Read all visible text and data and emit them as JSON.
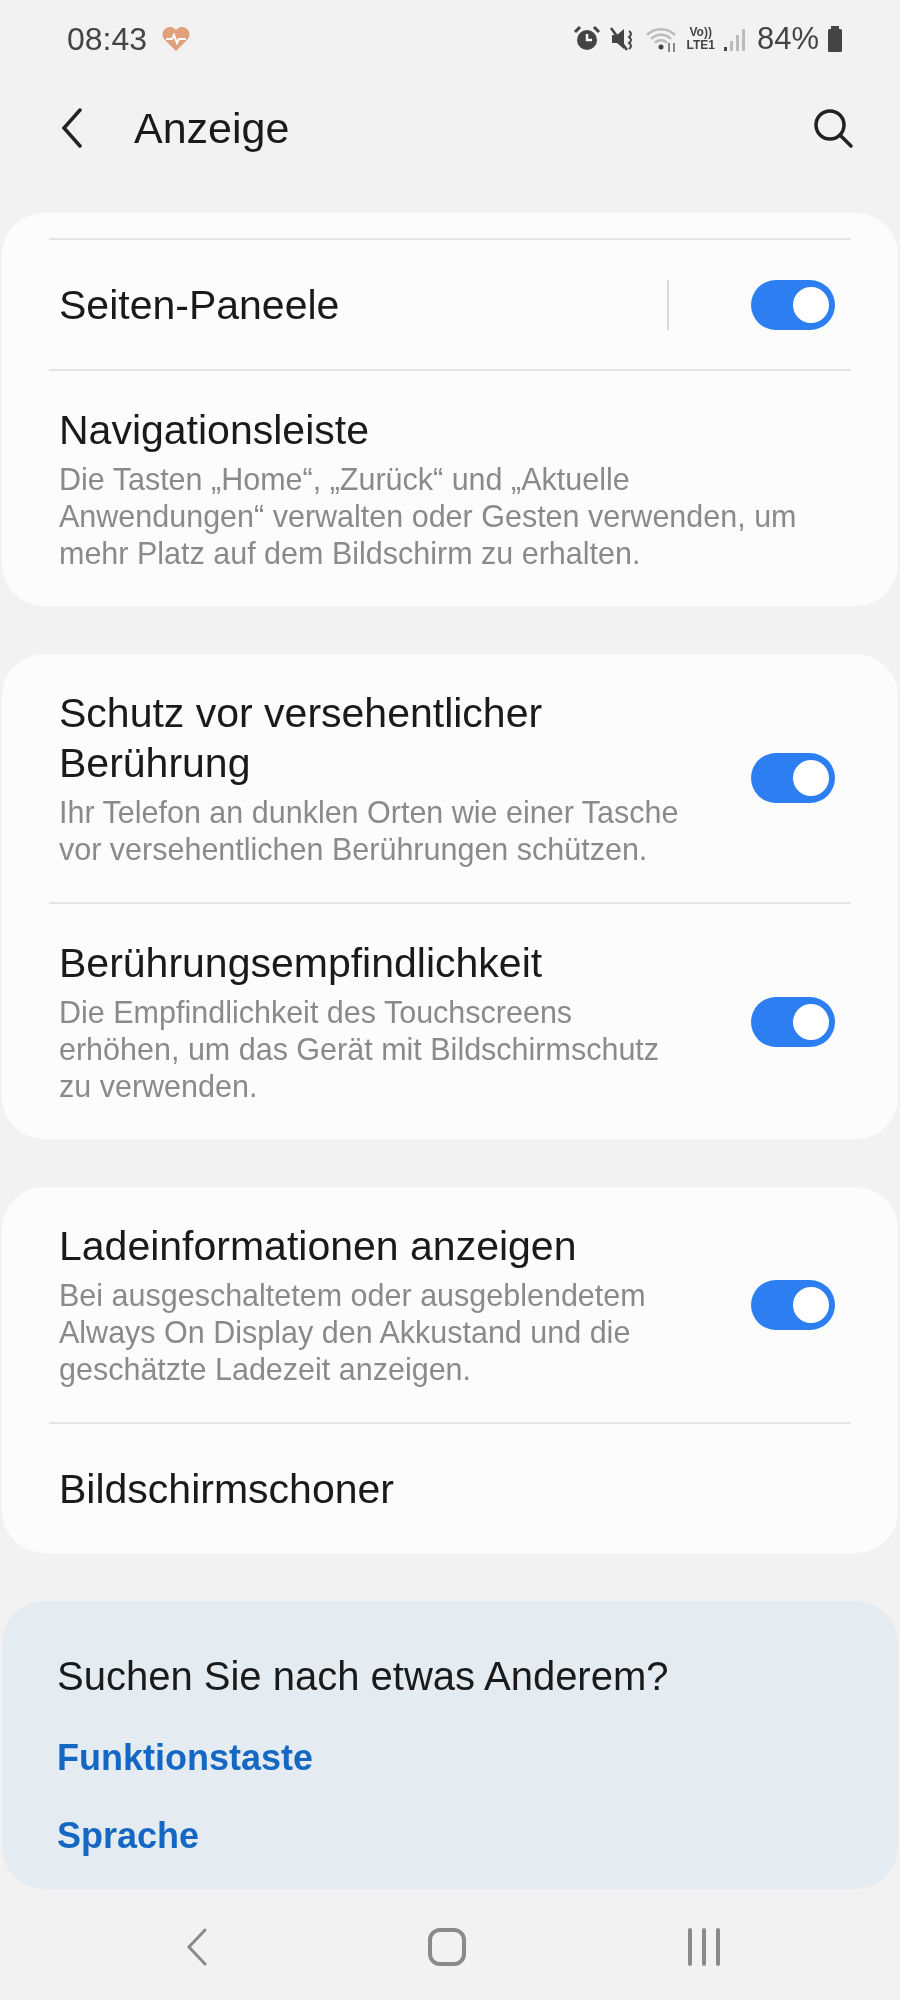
{
  "status_bar": {
    "time": "08:43",
    "volte": "Vo))",
    "network": "LTE1",
    "battery": "84%"
  },
  "header": {
    "title": "Anzeige"
  },
  "groups": [
    {
      "top_divider": true,
      "items": [
        {
          "kind": "toggle",
          "title": "Seiten-Paneele",
          "on": true,
          "separator": true
        },
        {
          "kind": "plain",
          "title": "Navigationsleiste",
          "description": "Die Tasten „Home“, „Zurück“ und „Aktuelle Anwendungen“ verwalten oder Gesten verwenden, um mehr Platz auf dem Bildschirm zu erhalten."
        }
      ]
    },
    {
      "top_divider": false,
      "items": [
        {
          "kind": "toggle",
          "title": "Schutz vor versehentlicher Berührung",
          "description": "Ihr Telefon an dunklen Orten wie einer Tasche vor versehentlichen Berührungen schützen.",
          "on": true
        },
        {
          "kind": "toggle",
          "title": "Berührungsempfindlichkeit",
          "description": "Die Empfindlichkeit des Touchscreens erhöhen, um das Gerät mit Bildschirmschutz zu verwenden.",
          "on": true
        }
      ]
    },
    {
      "top_divider": false,
      "items": [
        {
          "kind": "toggle",
          "title": "Ladeinformationen anzeigen",
          "description": "Bei ausgeschaltetem oder ausgeblendetem Always On Display den Akkustand und die geschätzte Ladezeit anzeigen.",
          "on": true
        },
        {
          "kind": "plain",
          "title": "Bildschirmschoner"
        }
      ]
    }
  ],
  "suggestions": {
    "title": "Suchen Sie nach etwas Anderem?",
    "links": [
      "Funktionstaste",
      "Sprache"
    ]
  }
}
